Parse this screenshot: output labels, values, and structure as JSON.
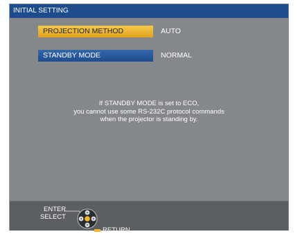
{
  "window": {
    "title": "INITIAL SETTING"
  },
  "menu": {
    "items": [
      {
        "label": "PROJECTION METHOD",
        "value": "AUTO",
        "state": "selected"
      },
      {
        "label": "STANDBY MODE",
        "value": "NORMAL",
        "state": "normal"
      }
    ]
  },
  "notice": {
    "lines": [
      "If STANDBY MODE is set to ECO,",
      "you cannot use some RS-232C protocol commands",
      "when the projector is standing by."
    ]
  },
  "footer": {
    "enter_label": "ENTER",
    "select_label": "SELECT",
    "return_label": "RETURN"
  },
  "colors": {
    "titlebar": "#1d4b8c",
    "selected_item": "#f0b83a",
    "normal_item": "#2b5b9e",
    "panel": "#85888b",
    "footer": "#5c5f62",
    "accent": "#f2b829"
  },
  "icons": [
    "direction-pad-icon",
    "enter-button-icon",
    "return-button-icon"
  ]
}
